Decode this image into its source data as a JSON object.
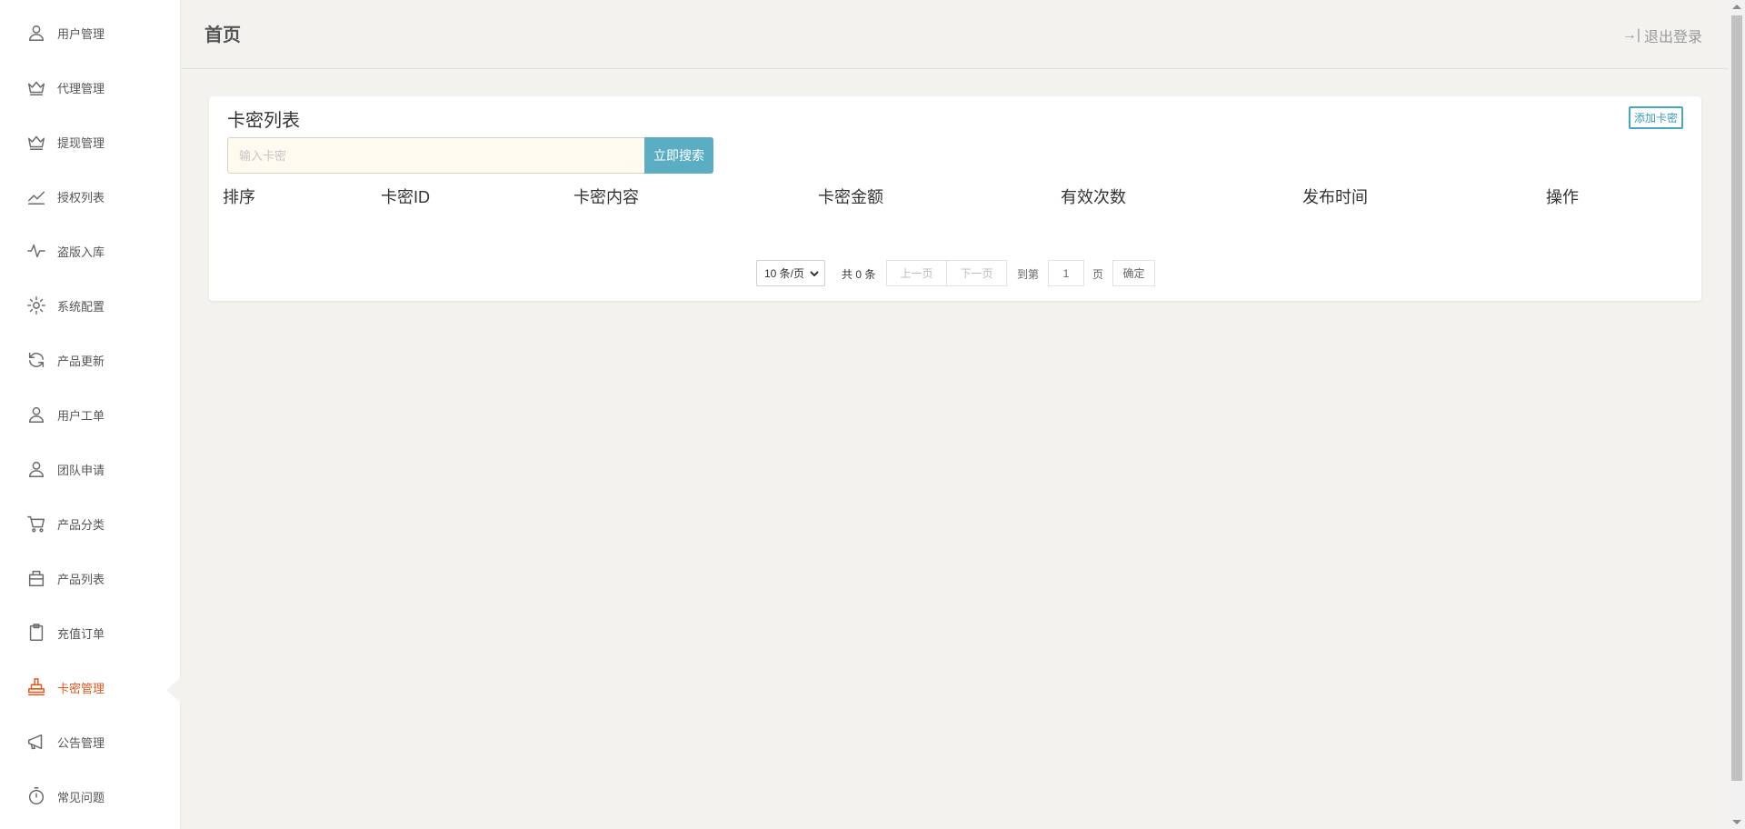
{
  "sidebar": {
    "items": [
      {
        "label": "用户管理",
        "icon": "user-icon"
      },
      {
        "label": "代理管理",
        "icon": "crown-icon"
      },
      {
        "label": "提现管理",
        "icon": "crown-icon"
      },
      {
        "label": "授权列表",
        "icon": "trend-icon"
      },
      {
        "label": "盗版入库",
        "icon": "pulse-icon"
      },
      {
        "label": "系统配置",
        "icon": "gear-icon"
      },
      {
        "label": "产品更新",
        "icon": "refresh-icon"
      },
      {
        "label": "用户工单",
        "icon": "user-icon"
      },
      {
        "label": "团队申请",
        "icon": "user-icon"
      },
      {
        "label": "产品分类",
        "icon": "cart-icon"
      },
      {
        "label": "产品列表",
        "icon": "box-icon"
      },
      {
        "label": "充值订单",
        "icon": "clipboard-icon"
      },
      {
        "label": "卡密管理",
        "icon": "stamp-icon",
        "active": true
      },
      {
        "label": "公告管理",
        "icon": "megaphone-icon"
      },
      {
        "label": "常见问题",
        "icon": "stopwatch-icon"
      }
    ]
  },
  "header": {
    "title": "首页",
    "logout_label": "退出登录",
    "logout_icon": "logout-icon"
  },
  "card": {
    "title": "卡密列表",
    "add_label": "添加卡密",
    "search": {
      "placeholder": "输入卡密",
      "value": "",
      "button_label": "立即搜索"
    },
    "columns": [
      "排序",
      "卡密ID",
      "卡密内容",
      "卡密金额",
      "有效次数",
      "发布时间",
      "操作"
    ],
    "rows": []
  },
  "pager": {
    "page_size": "10 条/页",
    "total": "共 0 条",
    "prev": "上一页",
    "next": "下一页",
    "goto_label": "到第",
    "page_value": "1",
    "page_unit": "页",
    "confirm": "确定"
  },
  "colors": {
    "accent_active": "#e8571d",
    "search_button": "#5aadc3",
    "add_button_border": "#4aa6c0"
  }
}
